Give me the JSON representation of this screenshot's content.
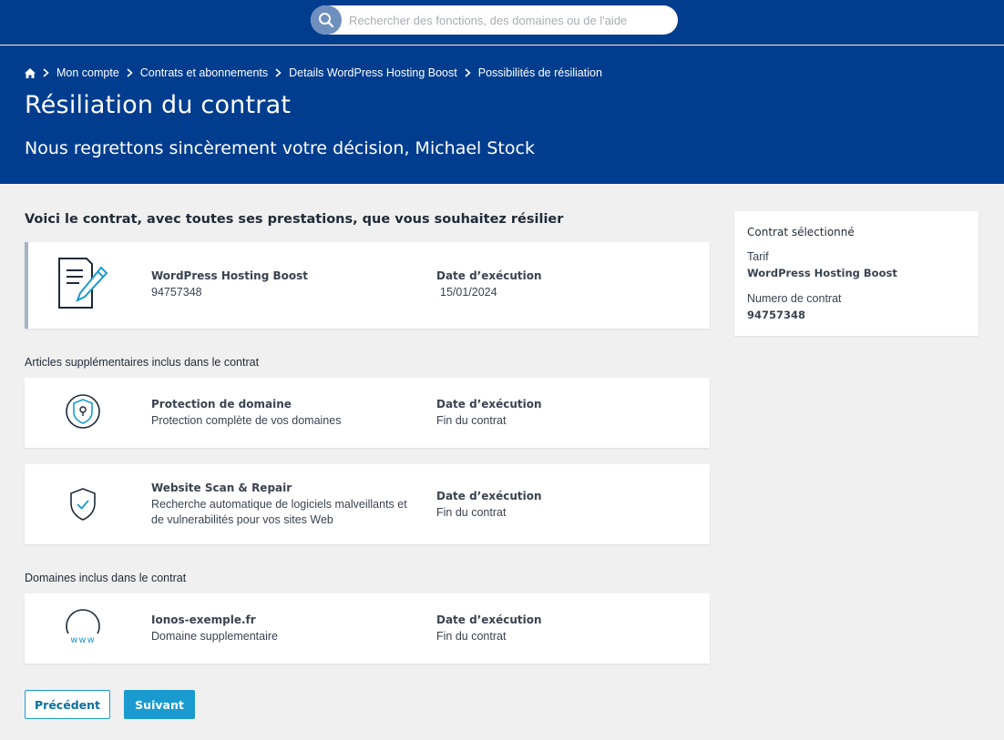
{
  "search": {
    "placeholder": "Rechercher des fonctions, des domaines ou de l'aide"
  },
  "breadcrumb": {
    "items": [
      "Mon compte",
      "Contrats et abonnements",
      "Details WordPress Hosting Boost",
      "Possibilités de résiliation"
    ]
  },
  "header": {
    "title": "Résiliation du contrat",
    "subtitle": "Nous regrettons sincèrement votre décision, Michael Stock"
  },
  "main": {
    "heading": "Voici le contrat, avec toutes ses prestations, que vous souhaitez résilier",
    "contract": {
      "name": "WordPress Hosting Boost",
      "number": "94757348",
      "date_label": "Date d’exécution",
      "date_value": "15/01/2024"
    },
    "extras_label": "Articles supplémentaires inclus dans le contrat",
    "extras": [
      {
        "icon": "lock-shield-icon",
        "name": "Protection de domaine",
        "desc": "Protection complète de vos domaines",
        "date_label": "Date d’exécution",
        "date_value": "Fin du contrat"
      },
      {
        "icon": "shield-check-icon",
        "name": "Website Scan & Repair",
        "desc_line1": "Recherche automatique de logiciels malveillants et",
        "desc_line2": "de vulnerabilités pour vos sites Web",
        "date_label": "Date d’exécution",
        "date_value": "Fin du contrat"
      }
    ],
    "domains_label": "Domaines inclus dans le contrat",
    "domain": {
      "icon": "www-globe-icon",
      "name": "Ionos-exemple.fr",
      "desc": "Domaine supplementaire",
      "date_label": "Date d’exécution",
      "date_value": "Fin du contrat"
    }
  },
  "sidebar": {
    "title": "Contrat sélectionné",
    "tarif_label": "Tarif",
    "tarif_value": "WordPress Hosting Boost",
    "numero_label": "Numero de contrat",
    "numero_value": "94757348"
  },
  "buttons": {
    "prev": "Précédent",
    "next": "Suivant"
  },
  "colors": {
    "brand": "#003d8f",
    "accent": "#1a9bd0",
    "background": "#f0f0f0"
  }
}
